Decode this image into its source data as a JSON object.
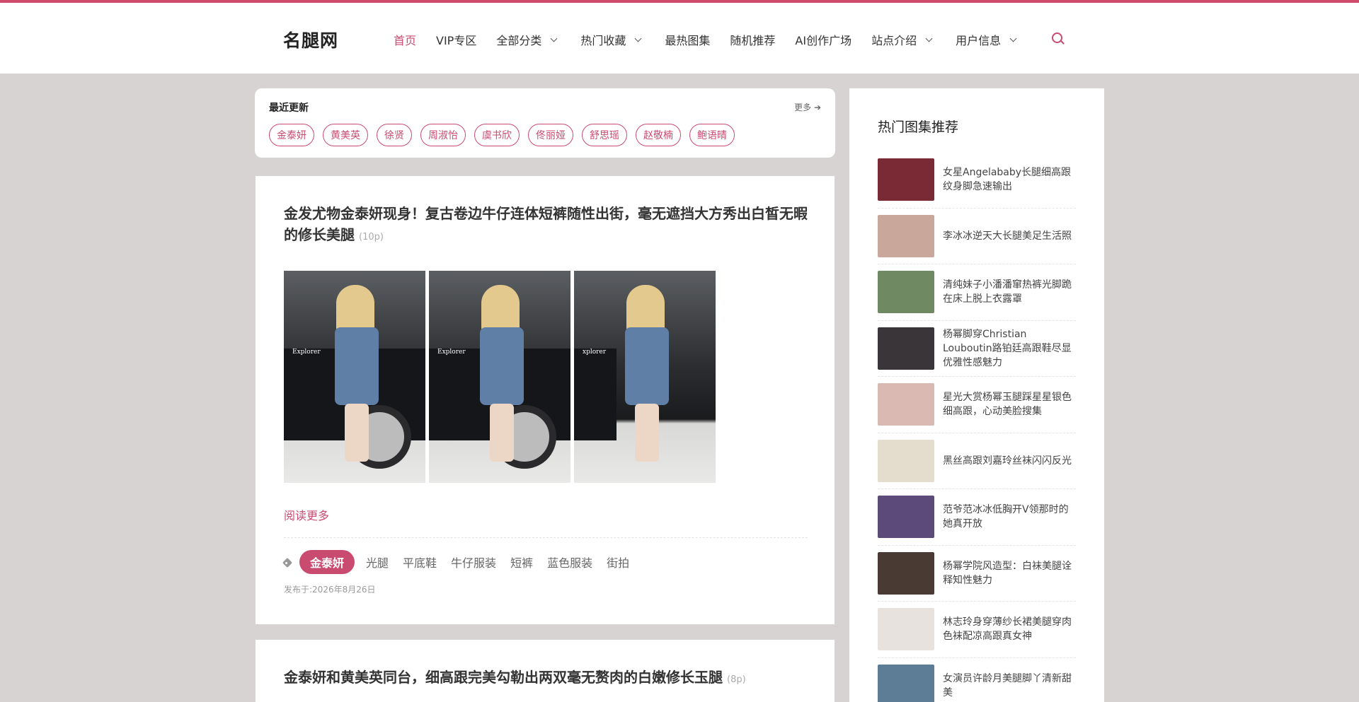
{
  "site": {
    "logo": "名腿网"
  },
  "nav": [
    {
      "label": "首页",
      "active": true,
      "dropdown": false
    },
    {
      "label": "VIP专区",
      "active": false,
      "dropdown": false
    },
    {
      "label": "全部分类",
      "active": false,
      "dropdown": true
    },
    {
      "label": "热门收藏",
      "active": false,
      "dropdown": true
    },
    {
      "label": "最热图集",
      "active": false,
      "dropdown": false
    },
    {
      "label": "随机推荐",
      "active": false,
      "dropdown": false
    },
    {
      "label": "AI创作广场",
      "active": false,
      "dropdown": false
    },
    {
      "label": "站点介绍",
      "active": false,
      "dropdown": true
    },
    {
      "label": "用户信息",
      "active": false,
      "dropdown": true
    }
  ],
  "recent": {
    "title": "最近更新",
    "more": "更多 ➔",
    "tags": [
      "金泰妍",
      "黄美英",
      "徐贤",
      "周淑怡",
      "虞书欣",
      "佟丽娅",
      "舒思瑶",
      "赵敬楠",
      "鲍语晴"
    ]
  },
  "posts": [
    {
      "title": "金发尤物金泰妍现身！复古卷边牛仔连体短裤随性出街，毫无遮挡大方秀出白皙无暇的修长美腿",
      "count": "(10p)",
      "thumb_labels": [
        "Explorer",
        "Explorer",
        "xplorer"
      ],
      "read_more": "阅读更多",
      "tag_highlight": "金泰妍",
      "tags": [
        "光腿",
        "平底鞋",
        "牛仔服装",
        "短裤",
        "蓝色服装",
        "街拍"
      ],
      "date": "发布于:2026年8月26日"
    },
    {
      "title": "金泰妍和黄美英同台，细高跟完美勾勒出两双毫无赘肉的白嫩修长玉腿",
      "count": "(8p)"
    }
  ],
  "sidebar": {
    "title": "热门图集推荐",
    "items": [
      {
        "text": "女星Angelababy长腿细高跟纹身脚急速输出",
        "color": "#7a2a35"
      },
      {
        "text": "李冰冰逆天大长腿美足生活照",
        "color": "#c9a89b"
      },
      {
        "text": "清纯妹子小潘潘窜热裤光脚跪在床上脱上衣露罩",
        "color": "#6f8a62"
      },
      {
        "text": "杨幂脚穿Christian Louboutin路铂廷高跟鞋尽显优雅性感魅力",
        "color": "#3a3538"
      },
      {
        "text": "星光大赏杨幂玉腿踩星星银色细高跟，心动美脸搜集",
        "color": "#d9b9b1"
      },
      {
        "text": "黑丝高跟刘嘉玲丝袜闪闪反光",
        "color": "#e4dccd"
      },
      {
        "text": "范爷范冰冰低胸开V领那时的她真开放",
        "color": "#5c4a7a"
      },
      {
        "text": "杨幂学院风造型：白袜美腿诠释知性魅力",
        "color": "#4a3a34"
      },
      {
        "text": "林志玲身穿薄纱长裙美腿穿肉色袜配凉高跟真女神",
        "color": "#e8e2df"
      },
      {
        "text": "女演员许龄月美腿脚丫清新甜美",
        "color": "#5d7c95"
      }
    ]
  }
}
